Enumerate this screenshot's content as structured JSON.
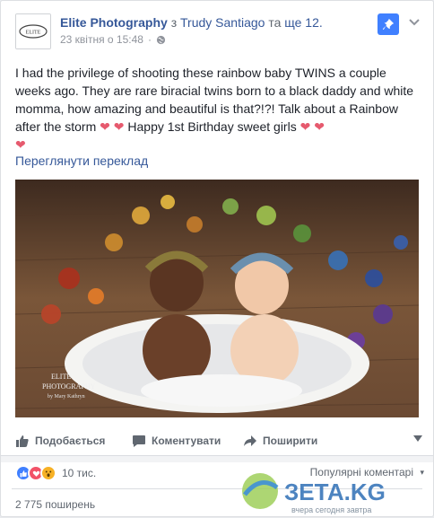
{
  "post": {
    "page_name": "Elite Photography",
    "with_prefix": "з",
    "with_person": "Trudy Santiago",
    "with_and": "та",
    "with_others": "ще 12.",
    "date": "23 квітня о 15:48",
    "dot": "·",
    "avatar_text": "ELITE",
    "text_main": "I had the privilege of shooting these rainbow baby TWINS a couple weeks ago. They are rare biracial twins born to a black daddy and white momma, how amazing and beautiful is that?!?! Talk about a Rainbow after the storm",
    "text_tail": "Happy 1st Birthday sweet girls",
    "heart_glyph": "❤",
    "see_translation": "Переглянути переклад"
  },
  "photo": {
    "watermark_line1": "ELITE",
    "watermark_line2": "PHOTOGRAPHY",
    "watermark_line3": "by Mary Kathryn"
  },
  "actions": {
    "like": "Подобається",
    "comment": "Коментувати",
    "share": "Поширити"
  },
  "reactions": {
    "count": "10 тис.",
    "top_comments": "Популярні коментарі",
    "top_caret": "▾"
  },
  "shares": {
    "label": "2 775 поширень"
  },
  "watermark": {
    "brand": "ЗЕТА.KG",
    "tagline": "вчера сегодня завтра"
  },
  "colors": {
    "link": "#365899",
    "accent": "#4080ff",
    "love": "#f25268",
    "wow": "#f7b125",
    "heart": "#e65a6e"
  },
  "icons": {
    "pin": "pin-icon",
    "chevron": "chevron-down-icon",
    "globe": "globe-icon",
    "like": "thumbs-up-icon",
    "comment": "comment-icon",
    "share": "share-arrow-icon"
  }
}
